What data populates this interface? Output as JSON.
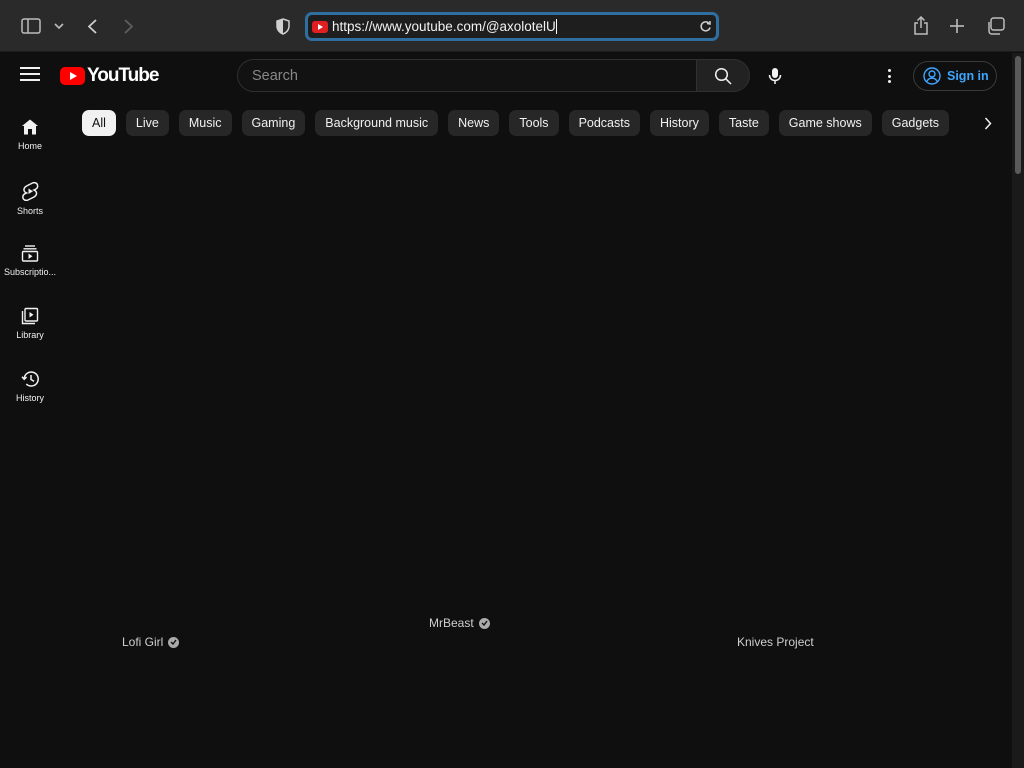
{
  "browser": {
    "url": "https://www.youtube.com/@axolotelU"
  },
  "masthead": {
    "logo_text": "YouTube",
    "search_placeholder": "Search",
    "signin_label": "Sign in"
  },
  "guide": {
    "items": [
      {
        "label": "Home",
        "icon": "home-icon"
      },
      {
        "label": "Shorts",
        "icon": "shorts-icon"
      },
      {
        "label": "Subscriptio...",
        "icon": "subscriptions-icon"
      },
      {
        "label": "Library",
        "icon": "library-icon"
      },
      {
        "label": "History",
        "icon": "history-icon"
      }
    ]
  },
  "chips": [
    "All",
    "Live",
    "Music",
    "Gaming",
    "Background music",
    "News",
    "Tools",
    "Podcasts",
    "History",
    "Taste",
    "Game shows",
    "Gadgets"
  ],
  "channels": [
    {
      "name": "Lofi Girl",
      "verified": true
    },
    {
      "name": "MrBeast",
      "verified": true
    },
    {
      "name": "Knives Project",
      "verified": false
    }
  ],
  "colors": {
    "background": "#0f0f0f",
    "accent_blue": "#3ea6ff",
    "brand_red": "#ff0000"
  }
}
